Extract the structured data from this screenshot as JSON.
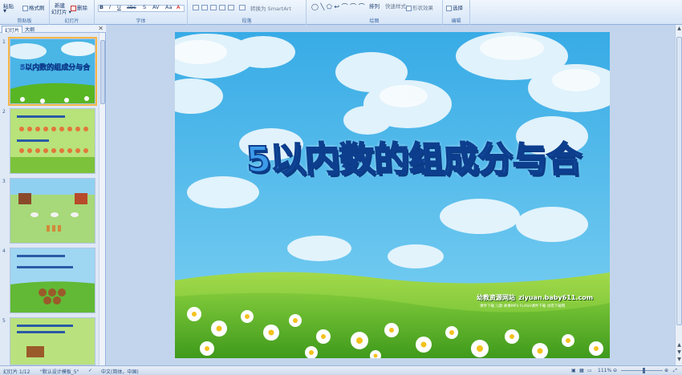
{
  "ribbon": {
    "clipboard": {
      "paste": "粘贴",
      "format_painter": "格式刷",
      "label": "剪贴板"
    },
    "slides": {
      "new_slide": "新建",
      "new_slide_sub": "幻灯片 ▾",
      "delete": "删除",
      "label": "幻灯片"
    },
    "font": {
      "label": "字体"
    },
    "paragraph": {
      "smartart": "转换为 SmartArt",
      "label": "段落"
    },
    "drawing": {
      "arrange": "排列",
      "quick_styles": "快速样式",
      "shape_effects": "形状效果",
      "label": "绘图"
    },
    "editing": {
      "select": "选择",
      "label": "编辑"
    }
  },
  "left_pane": {
    "tabs": [
      "幻灯片",
      "大纲"
    ],
    "close": "✕",
    "slide_numbers": [
      "1",
      "2",
      "3",
      "4",
      "5"
    ],
    "thumb_titles": [
      "5以内数的组成分与合",
      "",
      "",
      "",
      ""
    ]
  },
  "slide": {
    "title": "5以内数的组成分与合",
    "site_name": "幼教资源网站",
    "site_url": "ziyuan.baby611.com",
    "site_sub1": "课件下载  儿歌  故事MP3  FLASH课件下载  试卷下载网"
  },
  "status": {
    "slide_pos": "幻灯片 1/12",
    "theme": "\"默认设计模板_5\"",
    "lang": "中文(简体，中国)",
    "zoom": "111%"
  },
  "colors": {
    "ribbon_bg": "#dae8f8",
    "title_fill": "#3d9be9",
    "title_outline": "#0d3e8e",
    "sky": "#49b9e8",
    "grass": "#58b624"
  }
}
